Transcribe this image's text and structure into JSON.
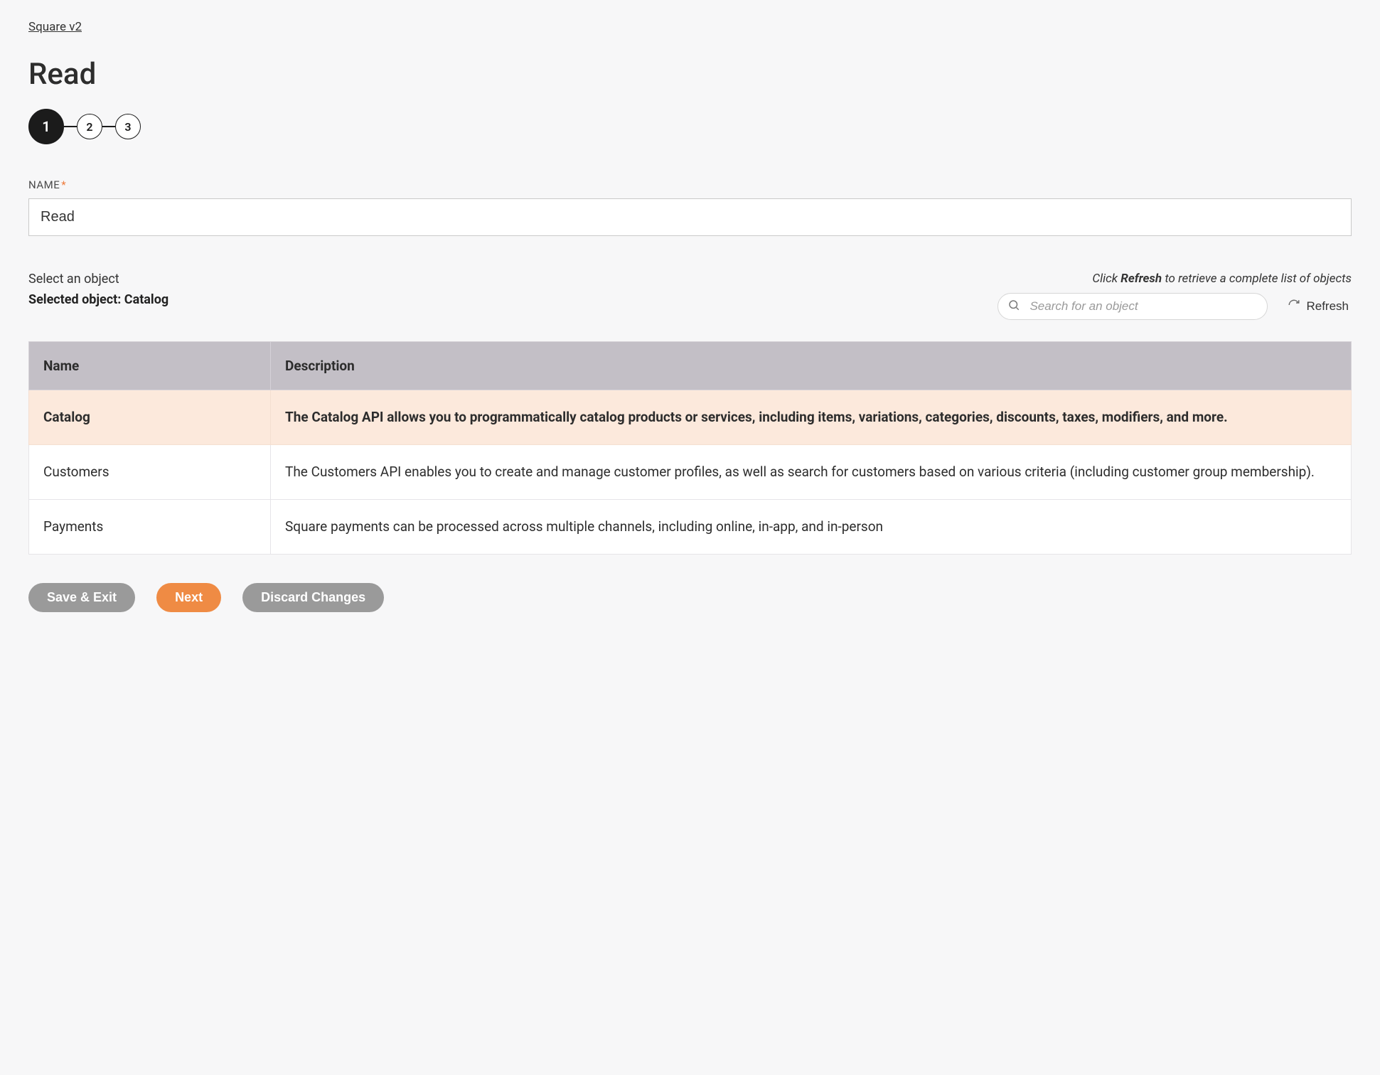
{
  "breadcrumb": "Square v2",
  "page_title": "Read",
  "stepper": {
    "steps": [
      "1",
      "2",
      "3"
    ],
    "active_index": 0
  },
  "name_field": {
    "label": "NAME",
    "required_marker": "*",
    "value": "Read"
  },
  "object_select": {
    "label": "Select an object",
    "selected_prefix": "Selected object: ",
    "selected_value": "Catalog",
    "hint_pre": "Click ",
    "hint_strong": "Refresh",
    "hint_post": " to retrieve a complete list of objects",
    "search_placeholder": "Search for an object",
    "refresh_label": "Refresh"
  },
  "table": {
    "headers": {
      "name": "Name",
      "description": "Description"
    },
    "rows": [
      {
        "name": "Catalog",
        "description": "The Catalog API allows you to programmatically catalog products or services, including items, variations, categories, discounts, taxes, modifiers, and more.",
        "selected": true
      },
      {
        "name": "Customers",
        "description": "The Customers API enables you to create and manage customer profiles, as well as search for customers based on various criteria (including customer group membership).",
        "selected": false
      },
      {
        "name": "Payments",
        "description": "Square payments can be processed across multiple channels, including online, in-app, and in-person",
        "selected": false
      }
    ]
  },
  "footer": {
    "save_exit": "Save & Exit",
    "next": "Next",
    "discard": "Discard Changes"
  }
}
